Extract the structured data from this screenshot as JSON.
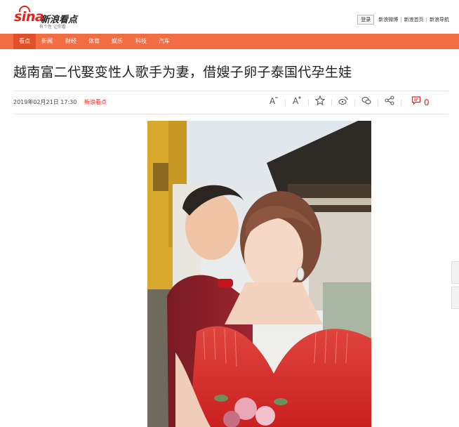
{
  "header": {
    "logo_text": "sina",
    "logo_sub": "新浪看点",
    "logo_slogan": "有个性 让你看",
    "login_label": "登录",
    "links": [
      "新浪微博",
      "新浪首页",
      "新浪导航"
    ]
  },
  "nav": {
    "items": [
      "看点",
      "新闻",
      "财经",
      "体育",
      "娱乐",
      "科技",
      "汽车"
    ],
    "active_index": 0
  },
  "article": {
    "title": "越南富二代娶变性人歌手为妻，借嫂子卵子泰国代孕生娃",
    "date": "2019年02月21日 17:30",
    "source": "新浪看点",
    "comment_count": "0"
  },
  "toolbar": {
    "icons": [
      "font-decrease-icon",
      "font-increase-icon",
      "favorite-star-icon",
      "weibo-share-icon",
      "wechat-share-icon",
      "share-icon",
      "comment-icon"
    ]
  },
  "colors": {
    "brand_red": "#e2231a",
    "nav_orange": "#f26d44",
    "nav_active": "#e2502a"
  }
}
